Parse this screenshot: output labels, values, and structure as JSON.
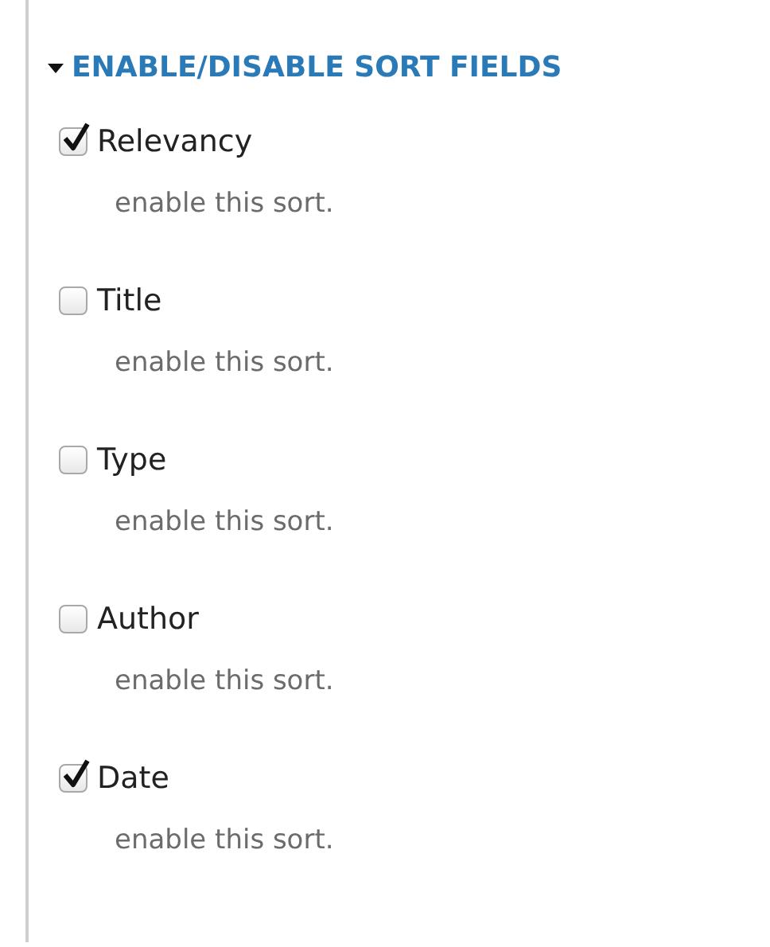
{
  "fieldset": {
    "title": "ENABLE/DISABLE SORT FIELDS",
    "expanded": true,
    "items": [
      {
        "label": "Relevancy",
        "checked": true,
        "description": "enable this sort."
      },
      {
        "label": "Title",
        "checked": false,
        "description": "enable this sort."
      },
      {
        "label": "Type",
        "checked": false,
        "description": "enable this sort."
      },
      {
        "label": "Author",
        "checked": false,
        "description": "enable this sort."
      },
      {
        "label": "Date",
        "checked": true,
        "description": "enable this sort."
      }
    ]
  }
}
